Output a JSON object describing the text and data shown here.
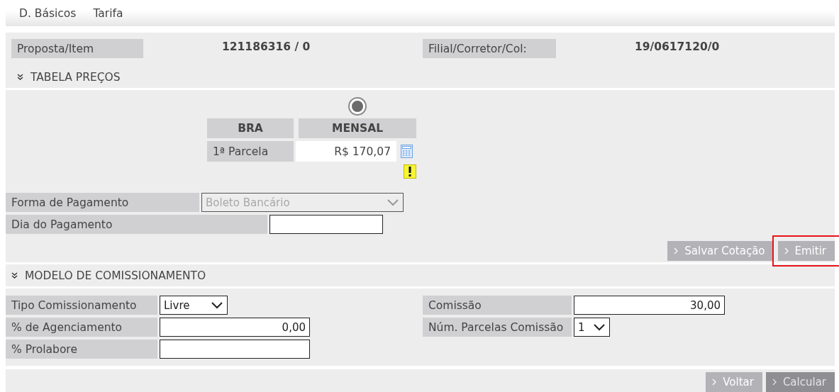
{
  "tabs": [
    {
      "label": "D. Básicos"
    },
    {
      "label": "Tarifa"
    }
  ],
  "header": [
    {
      "label": "Proposta/Item",
      "value": "121186316 / 0"
    },
    {
      "label": "Filial/Corretor/Col:",
      "value": "19/0617120/0"
    }
  ],
  "price_section": {
    "title": "TABELA PREÇOS",
    "expanded": true
  },
  "price_table": {
    "option_selected": true,
    "columns": [
      "BRA",
      "MENSAL"
    ],
    "rows": [
      {
        "label": "1ª Parcela",
        "value": "R$ 170,07"
      }
    ]
  },
  "payment_fields": [
    {
      "kind": "select",
      "label": "Forma de Pagamento",
      "value": "Boleto Bancário",
      "disabled": true
    },
    {
      "kind": "input",
      "label": "Dia do Pagamento"
    }
  ],
  "actions": [
    {
      "label": "Salvar Cotação",
      "disabled": false,
      "highlighted": false
    },
    {
      "label": "Emitir",
      "disabled": false,
      "highlighted": true
    }
  ],
  "commission_section": {
    "title": "MODELO DE COMISSIONAMENTO",
    "expanded": true
  },
  "commission_left": [
    {
      "kind": "select",
      "label": "Tipo Comissionamento",
      "value": "Livre"
    },
    {
      "kind": "input",
      "label": "% de Agenciamento",
      "value": "0,00"
    },
    {
      "kind": "input",
      "label": "% Prolabore"
    }
  ],
  "commission_right": [
    {
      "kind": "input",
      "label": "Comissão",
      "value": "30,00"
    },
    {
      "kind": "select",
      "label": "Núm. Parcelas Comissão",
      "value": "1"
    }
  ],
  "footer_buttons": [
    {
      "label": "Voltar",
      "disabled": false
    },
    {
      "label": "Calcular",
      "disabled": true
    }
  ]
}
